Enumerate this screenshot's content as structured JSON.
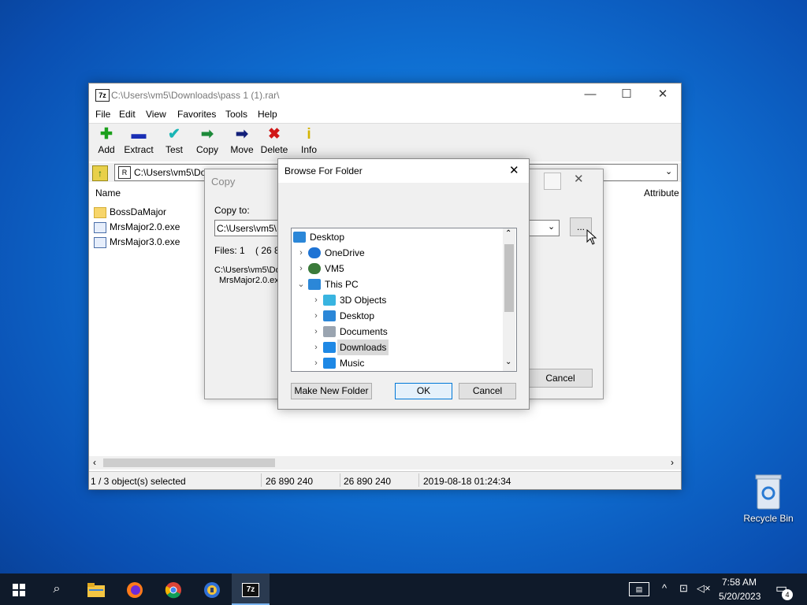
{
  "main_window": {
    "title": "C:\\Users\\vm5\\Downloads\\pass 1 (1).rar\\",
    "app_icon": "7z",
    "window_buttons": {
      "minimize": "—",
      "maximize": "☐",
      "close": "✕"
    },
    "menu": [
      "File",
      "Edit",
      "View",
      "Favorites",
      "Tools",
      "Help"
    ],
    "toolbar": [
      {
        "label": "Add",
        "icon": "plus-icon",
        "glyph": "✚",
        "color": "#1ca01c"
      },
      {
        "label": "Extract",
        "icon": "minus-icon",
        "glyph": "▬",
        "color": "#1a2fb5"
      },
      {
        "label": "Test",
        "icon": "check-icon",
        "glyph": "✔",
        "color": "#1ab5b5"
      },
      {
        "label": "Copy",
        "icon": "copy-arrow-icon",
        "glyph": "➡",
        "color": "#1d8a3a"
      },
      {
        "label": "Move",
        "icon": "move-arrow-icon",
        "glyph": "➡",
        "color": "#13207a"
      },
      {
        "label": "Delete",
        "icon": "delete-x-icon",
        "glyph": "✖",
        "color": "#d01818"
      },
      {
        "label": "Info",
        "icon": "info-icon",
        "glyph": "i",
        "color": "#d4b400"
      }
    ],
    "address": "C:\\Users\\vm5\\Do",
    "columns": {
      "name": "Name",
      "attributes": "Attribute"
    },
    "files": [
      {
        "name": "BossDaMajor",
        "type": "folder"
      },
      {
        "name": "MrsMajor2.0.exe",
        "type": "exe"
      },
      {
        "name": "MrsMajor3.0.exe",
        "type": "exe"
      }
    ],
    "status": {
      "selected": "1 / 3 object(s) selected",
      "size": "26 890 240",
      "packed": "26 890 240",
      "modified": "2019-08-18 01:24:34"
    }
  },
  "copy_dialog": {
    "title": "Copy",
    "copy_to_label": "Copy to:",
    "path_value": "C:\\Users\\vm5\\D",
    "browse_button": "...",
    "files_info": "Files: 1    ( 26 890",
    "source_line1": "C:\\Users\\vm5\\Do",
    "source_line2": "MrsMajor2.0.exe",
    "cancel": "Cancel"
  },
  "browse_dialog": {
    "title": "Browse For Folder",
    "close": "✕",
    "tree": [
      {
        "label": "Desktop",
        "level": 0,
        "chevron": "",
        "icon": "desktop-icon",
        "color": "#2b87d8"
      },
      {
        "label": "OneDrive",
        "level": 1,
        "chevron": "›",
        "icon": "cloud-icon",
        "color": "#1e73d4"
      },
      {
        "label": "VM5",
        "level": 1,
        "chevron": "›",
        "icon": "user-icon",
        "color": "#3a7a3a"
      },
      {
        "label": "This PC",
        "level": 1,
        "chevron": "⌄",
        "icon": "pc-icon",
        "color": "#2b87d8"
      },
      {
        "label": "3D Objects",
        "level": 2,
        "chevron": "›",
        "icon": "cube-icon",
        "color": "#39b4e0"
      },
      {
        "label": "Desktop",
        "level": 2,
        "chevron": "›",
        "icon": "desktop-icon",
        "color": "#2b87d8"
      },
      {
        "label": "Documents",
        "level": 2,
        "chevron": "›",
        "icon": "document-icon",
        "color": "#9aa4b0"
      },
      {
        "label": "Downloads",
        "level": 2,
        "chevron": "›",
        "icon": "download-icon",
        "color": "#1e88e5",
        "selected": true
      },
      {
        "label": "Music",
        "level": 2,
        "chevron": "›",
        "icon": "music-icon",
        "color": "#1e88e5"
      }
    ],
    "buttons": {
      "new_folder": "Make New Folder",
      "ok": "OK",
      "cancel": "Cancel"
    }
  },
  "desktop": {
    "recycle_bin": "Recycle Bin"
  },
  "taskbar": {
    "apps": [
      "start-icon",
      "search-icon",
      "file-explorer-icon",
      "firefox-icon",
      "chrome-icon",
      "browser-icon",
      "7zip-icon"
    ],
    "time": "7:58 AM",
    "date": "5/20/2023",
    "notification_count": "4"
  }
}
